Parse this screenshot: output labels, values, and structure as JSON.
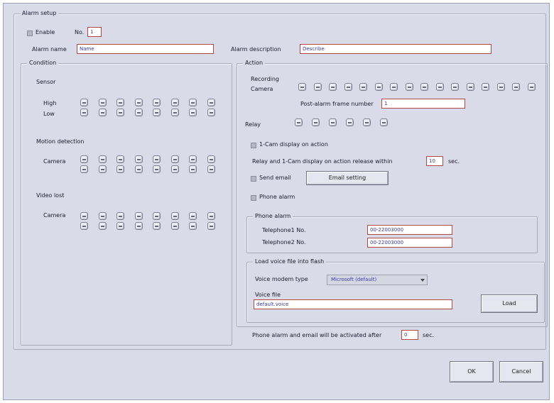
{
  "window": {
    "title": "Alarm setup"
  },
  "general": {
    "enable_label": "Enable",
    "no_label": "No.",
    "no_value": "1",
    "name_label": "Alarm name",
    "name_value": "Name",
    "desc_label": "Alarm description",
    "desc_value": "Describe"
  },
  "condition": {
    "title": "Condition",
    "sensor_label": "Sensor",
    "high_label": "High",
    "low_label": "Low",
    "motion_label": "Motion detection",
    "motion_camera_label": "Camera",
    "videolost_label": "Video lost",
    "videolost_camera_label": "Camera",
    "columns": 8
  },
  "action": {
    "title": "Action",
    "recording_label": "Recording",
    "camera_label": "Camera",
    "recording_camera_count": 16,
    "preframe_label": "Post-alarm frame number",
    "preframe_value": "1",
    "relay_label": "Relay",
    "relay_count": 6,
    "onecam_label": "1-Cam display on action",
    "release_label": "Relay and 1-Cam display on action release within",
    "release_value": "10",
    "release_unit": "sec.",
    "email_label": "Send email",
    "email_button": "Email setting",
    "phone_label": "Phone alarm",
    "phone_group_title": "Phone alarm",
    "tel1_label": "Telephone1 No.",
    "tel1_value": "00-22003000",
    "tel2_label": "Telephone2 No.",
    "tel2_value": "00-22003000",
    "voice_group_title": "Load voice file into flash",
    "voice_type_label": "Voice modem type",
    "voice_type_value": "Microsoft (default)",
    "voice_file_label": "Voice file",
    "voice_file_value": "default.voice",
    "load_button": "Load"
  },
  "footer": {
    "after_label": "Phone alarm and email will be activated after",
    "after_value": "0",
    "after_unit": "sec.",
    "ok_button": "OK",
    "cancel_button": "Cancel"
  }
}
